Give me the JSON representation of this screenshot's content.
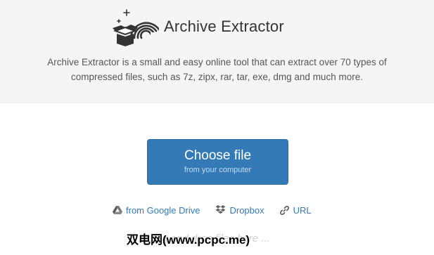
{
  "header": {
    "title": "Archive Extractor",
    "description": "Archive Extractor is a small and easy online tool that can extract over 70 types of compressed files, such as 7z, zipx, rar, tar, exe, dmg and much more."
  },
  "upload": {
    "choose_label": "Choose file",
    "choose_sublabel": "from your computer"
  },
  "sources": [
    {
      "label": "from Google Drive",
      "icon": "google-drive-icon"
    },
    {
      "label": "Dropbox",
      "icon": "dropbox-icon"
    },
    {
      "label": "URL",
      "icon": "link-icon"
    }
  ],
  "faded_text": "... drag and drop files here ...",
  "watermark": "双电网(www.pcpc.me)",
  "colors": {
    "accent": "#337ab7",
    "header_bg": "#f5f5f5",
    "title": "#333333",
    "text": "#555555"
  }
}
